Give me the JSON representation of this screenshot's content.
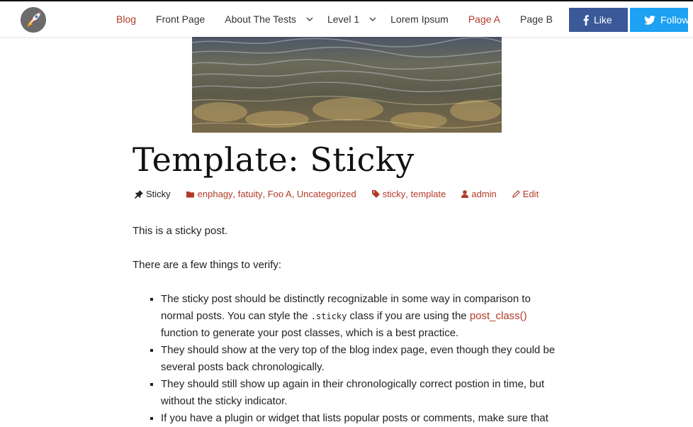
{
  "header": {
    "nav": [
      {
        "label": "Blog",
        "accent": true,
        "dropdown": false
      },
      {
        "label": "Front Page",
        "accent": false,
        "dropdown": false
      },
      {
        "label": "About The Tests",
        "accent": false,
        "dropdown": true
      },
      {
        "label": "Level 1",
        "accent": false,
        "dropdown": true
      },
      {
        "label": "Lorem Ipsum",
        "accent": false,
        "dropdown": false
      },
      {
        "label": "Page A",
        "accent": true,
        "dropdown": false
      },
      {
        "label": "Page B",
        "accent": false,
        "dropdown": false
      }
    ],
    "like_label": "Like",
    "follow_label": "Follow"
  },
  "post": {
    "title": "Template: Sticky",
    "sticky_label": "Sticky",
    "categories": [
      "enphagy",
      "fatuity",
      "Foo A",
      "Uncategorized"
    ],
    "tags": [
      "sticky",
      "template"
    ],
    "author": "admin",
    "edit_label": "Edit",
    "p1": "This is a sticky post.",
    "p2": "There are a few things to verify:",
    "li1_a": "The sticky post should be distinctly recognizable in some way in comparison to normal posts. You can style the ",
    "li1_code": ".sticky",
    "li1_b": " class if you are using the ",
    "li1_link": "post_class()",
    "li1_c": " function to generate your post classes, which is a best practice.",
    "li2": "They should show at the very top of the blog index page, even though they could be several posts back chronologically.",
    "li3": "They should still show up again in their chronologically correct postion in time, but without the sticky indicator.",
    "li4": "If you have a plugin or widget that lists popular posts or comments, make sure that"
  },
  "colors": {
    "accent": "#b23b27",
    "facebook": "#3b5998",
    "twitter": "#1da1f2"
  }
}
